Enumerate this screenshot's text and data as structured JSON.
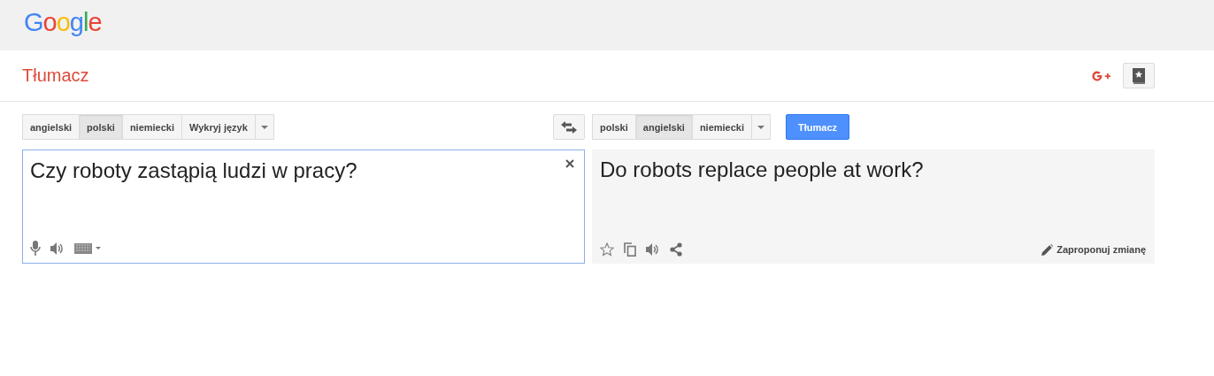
{
  "logo": "Google",
  "app_title": "Tłumacz",
  "source_languages": [
    {
      "label": "angielski",
      "selected": false
    },
    {
      "label": "polski",
      "selected": true
    },
    {
      "label": "niemiecki",
      "selected": false
    },
    {
      "label": "Wykryj język",
      "selected": false
    }
  ],
  "target_languages": [
    {
      "label": "polski",
      "selected": false
    },
    {
      "label": "angielski",
      "selected": true
    },
    {
      "label": "niemiecki",
      "selected": false
    }
  ],
  "translate_button": "Tłumacz",
  "source_text": "Czy roboty zastąpią ludzi w pracy?",
  "result_text": "Do robots replace people at work?",
  "suggest_edit": "Zaproponuj zmianę"
}
